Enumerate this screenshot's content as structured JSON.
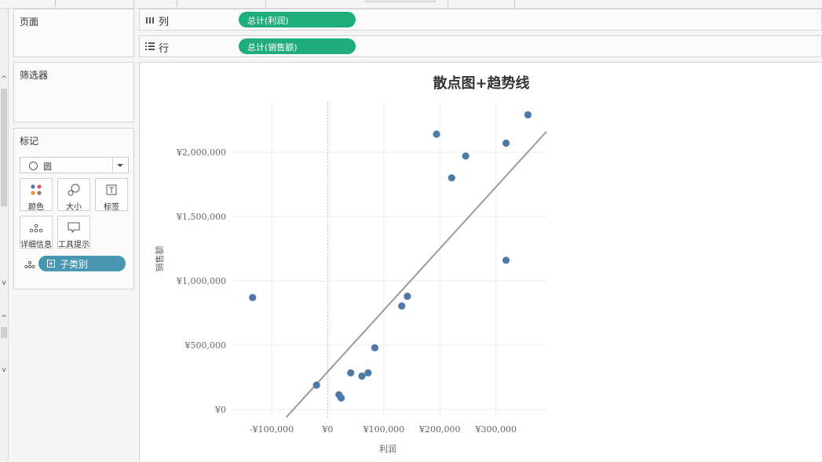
{
  "shelves": {
    "columns": {
      "label": "列",
      "pill": "总计(利润)"
    },
    "rows": {
      "label": "行",
      "pill": "总计(销售额)"
    }
  },
  "panels": {
    "pages": "页面",
    "filters": "筛选器",
    "marks": {
      "title": "标记",
      "mark_type": "圆",
      "buttons": [
        "颜色",
        "大小",
        "标签",
        "详细信息",
        "工具提示"
      ],
      "detail_pill": "子类别"
    }
  },
  "colors": {
    "pill_green": "#1fae7b",
    "pill_blue": "#4996b2",
    "mark": "#4e79a7",
    "trend": "#9a9a9a"
  },
  "chart_data": {
    "type": "scatter",
    "title": "散点图+趋势线",
    "xlabel": "利润",
    "ylabel": "销售额",
    "xlim": [
      -170000,
      390000
    ],
    "ylim": [
      -60000,
      2390000
    ],
    "x_ticks": [
      -100000,
      0,
      100000,
      200000,
      300000
    ],
    "x_tick_labels": [
      "-¥100,000",
      "¥0",
      "¥100,000",
      "¥200,000",
      "¥300,000"
    ],
    "y_ticks": [
      0,
      500000,
      1000000,
      1500000,
      2000000
    ],
    "y_tick_labels": [
      "¥0",
      "¥500,000",
      "¥1,000,000",
      "¥1,500,000",
      "¥2,000,000"
    ],
    "grid": true,
    "points": [
      {
        "x": -134000,
        "y": 870000
      },
      {
        "x": -20000,
        "y": 190000
      },
      {
        "x": 20000,
        "y": 115000
      },
      {
        "x": 24000,
        "y": 90000
      },
      {
        "x": 41000,
        "y": 285000
      },
      {
        "x": 61000,
        "y": 260000
      },
      {
        "x": 72000,
        "y": 285000
      },
      {
        "x": 84000,
        "y": 480000
      },
      {
        "x": 132000,
        "y": 805000
      },
      {
        "x": 142000,
        "y": 880000
      },
      {
        "x": 194000,
        "y": 2140000
      },
      {
        "x": 221000,
        "y": 1800000
      },
      {
        "x": 246000,
        "y": 1970000
      },
      {
        "x": 318000,
        "y": 2070000
      },
      {
        "x": 318000,
        "y": 1160000
      },
      {
        "x": 357000,
        "y": 2290000
      }
    ],
    "trendline": {
      "start": {
        "x": -74000,
        "y": -60000
      },
      "end": {
        "x": 390000,
        "y": 2160000
      }
    }
  }
}
